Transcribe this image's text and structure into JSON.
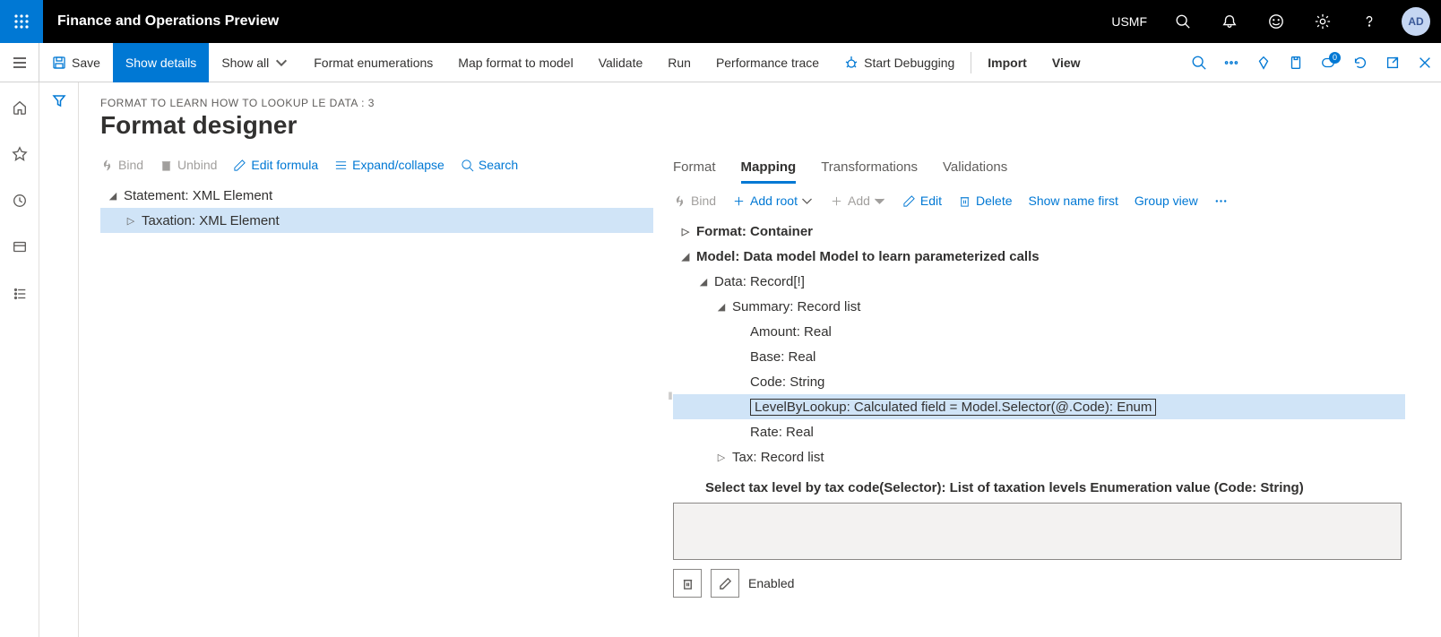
{
  "topbar": {
    "app_title": "Finance and Operations Preview",
    "company": "USMF",
    "avatar": "AD"
  },
  "commandbar": {
    "save": "Save",
    "show_details": "Show details",
    "show_all": "Show all",
    "format_enumerations": "Format enumerations",
    "map_format_to_model": "Map format to model",
    "validate": "Validate",
    "run": "Run",
    "performance_trace": "Performance trace",
    "start_debugging": "Start Debugging",
    "import": "Import",
    "view": "View",
    "badge_count": "0"
  },
  "breadcrumb": "FORMAT TO LEARN HOW TO LOOKUP LE DATA : 3",
  "page_title": "Format designer",
  "left_toolbar": {
    "bind": "Bind",
    "unbind": "Unbind",
    "edit_formula": "Edit formula",
    "expand_collapse": "Expand/collapse",
    "search": "Search"
  },
  "format_tree": {
    "root": "Statement: XML Element",
    "child": "Taxation: XML Element"
  },
  "tabs": {
    "format": "Format",
    "mapping": "Mapping",
    "transformations": "Transformations",
    "validations": "Validations"
  },
  "right_toolbar": {
    "bind": "Bind",
    "add_root": "Add root",
    "add": "Add",
    "edit": "Edit",
    "delete": "Delete",
    "show_name_first": "Show name first",
    "group_view": "Group view"
  },
  "mapping_tree": {
    "format_container": "Format: Container",
    "model": "Model: Data model Model to learn parameterized calls",
    "data_record": "Data: Record[!]",
    "summary": "Summary: Record list",
    "amount": "Amount: Real",
    "base": "Base: Real",
    "code": "Code: String",
    "level_by_lookup": "LevelByLookup: Calculated field = Model.Selector(@.Code): Enum",
    "rate": "Rate: Real",
    "tax": "Tax: Record list",
    "selector_desc": "Select tax level by tax code(Selector): List of taxation levels Enumeration value (Code: String)"
  },
  "detail": {
    "enabled_label": "Enabled"
  }
}
